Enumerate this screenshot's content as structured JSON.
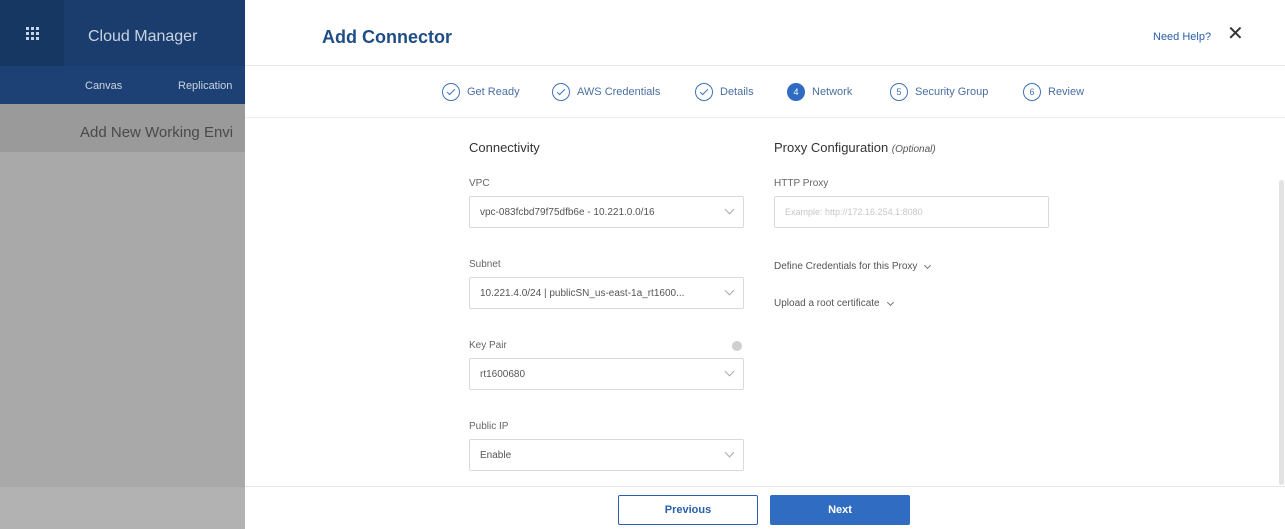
{
  "background": {
    "app_title": "Cloud Manager",
    "nav": [
      "Canvas",
      "Replication"
    ],
    "sub_text": "Add New Working Envi"
  },
  "modal": {
    "title": "Add Connector",
    "help_link": "Need Help?",
    "close_glyph": "✕"
  },
  "steps": [
    {
      "label": "Get Ready",
      "state": "done"
    },
    {
      "label": "AWS Credentials",
      "state": "done"
    },
    {
      "label": "Details",
      "state": "done"
    },
    {
      "label": "Network",
      "state": "active",
      "number": "4"
    },
    {
      "label": "Security Group",
      "state": "pending",
      "number": "5"
    },
    {
      "label": "Review",
      "state": "pending",
      "number": "6"
    }
  ],
  "connectivity": {
    "title": "Connectivity",
    "vpc_label": "VPC",
    "vpc_value": "vpc-083fcbd79f75dfb6e - 10.221.0.0/16",
    "subnet_label": "Subnet",
    "subnet_value": "10.221.4.0/24 | publicSN_us-east-1a_rt1600...",
    "keypair_label": "Key Pair",
    "keypair_value": "rt1600680",
    "publicip_label": "Public IP",
    "publicip_value": "Enable"
  },
  "proxy": {
    "title": "Proxy Configuration",
    "optional": "(Optional)",
    "http_label": "HTTP Proxy",
    "http_placeholder": "Example: http://172.16.254.1:8080",
    "define_credentials": "Define Credentials for this Proxy",
    "upload_cert": "Upload a root certificate"
  },
  "footer": {
    "previous": "Previous",
    "next": "Next"
  },
  "colors": {
    "accent": "#2f6cc2",
    "nav_dark": "#1a3d6e",
    "title_blue": "#1f4d86"
  }
}
